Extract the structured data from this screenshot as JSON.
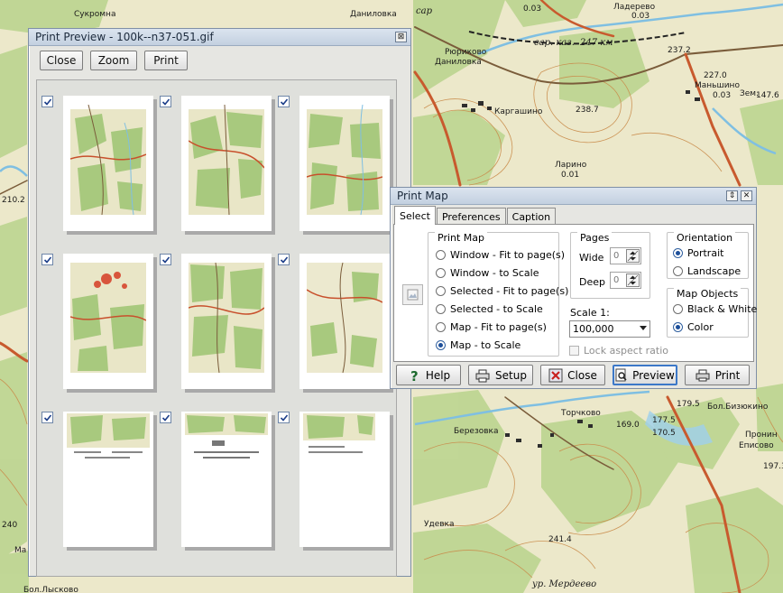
{
  "map": {
    "labels": [
      "Сукромна",
      "Даниловка",
      "сар",
      "Ладерево",
      "Рюриково",
      "Даниловка",
      "сар. каз.",
      "247 км",
      "Маньшино",
      "Каргашино",
      "Ларино",
      "Зем.",
      "Торчково",
      "Бол.Бизюкино",
      "Березовка",
      "Пронин",
      "Еписово",
      "Удевка",
      "ур. Мердеево",
      "Ма",
      "Бол.Лысково"
    ],
    "elevations": [
      "0.03",
      "237.2",
      "227.0",
      "0.03",
      "147.6",
      "238.7",
      "0.01",
      "0.03",
      "179.5",
      "169.0",
      "177.5",
      "170.5",
      "197.3",
      "241.4",
      "210.2",
      "240"
    ]
  },
  "preview_window": {
    "title": "Print Preview - 100k--n37-051.gif",
    "close_x": "⊠",
    "buttons": {
      "close": "Close",
      "zoom": "Zoom",
      "print": "Print"
    },
    "pages": [
      {
        "checked": true
      },
      {
        "checked": true
      },
      {
        "checked": true
      },
      {
        "checked": true
      },
      {
        "checked": true
      },
      {
        "checked": true
      },
      {
        "checked": true
      },
      {
        "checked": true
      },
      {
        "checked": true
      }
    ]
  },
  "print_map": {
    "title": "Print Map",
    "title_buttons": {
      "restore": "⇕",
      "close": "✕"
    },
    "tabs": {
      "select": "Select",
      "preferences": "Preferences",
      "caption": "Caption"
    },
    "active_tab": "Select",
    "print_map_group": {
      "legend": "Print Map",
      "options": [
        {
          "label": "Window - Fit to page(s)",
          "selected": false
        },
        {
          "label": "Window - to Scale",
          "selected": false
        },
        {
          "label": "Selected - Fit to page(s)",
          "selected": false
        },
        {
          "label": "Selected - to Scale",
          "selected": false
        },
        {
          "label": "Map - Fit to page(s)",
          "selected": false
        },
        {
          "label": "Map - to Scale",
          "selected": true
        }
      ]
    },
    "pages_group": {
      "legend": "Pages",
      "wide_label": "Wide",
      "wide_value": "0",
      "deep_label": "Deep",
      "deep_value": "0"
    },
    "scale": {
      "label": "Scale 1:",
      "value": "100,000"
    },
    "lock_aspect": {
      "label": "Lock aspect ratio",
      "checked": false
    },
    "orientation": {
      "legend": "Orientation",
      "options": [
        {
          "label": "Portrait",
          "selected": true
        },
        {
          "label": "Landscape",
          "selected": false
        }
      ]
    },
    "map_objects": {
      "legend": "Map Objects",
      "options": [
        {
          "label": "Black & White",
          "selected": false
        },
        {
          "label": "Color",
          "selected": true
        }
      ]
    },
    "buttons": {
      "help": "Help",
      "setup": "Setup",
      "close": "Close",
      "preview": "Preview",
      "print": "Print"
    }
  },
  "colors": {
    "map_background": "#e8e4c4",
    "forest_green": "#b9d38c",
    "water_blue": "#88c4e4",
    "contour_brown": "#c8843c",
    "road_red": "#c8502c",
    "title_bar": "#c8d4e2",
    "radio_selected": "#1d4f9a"
  }
}
